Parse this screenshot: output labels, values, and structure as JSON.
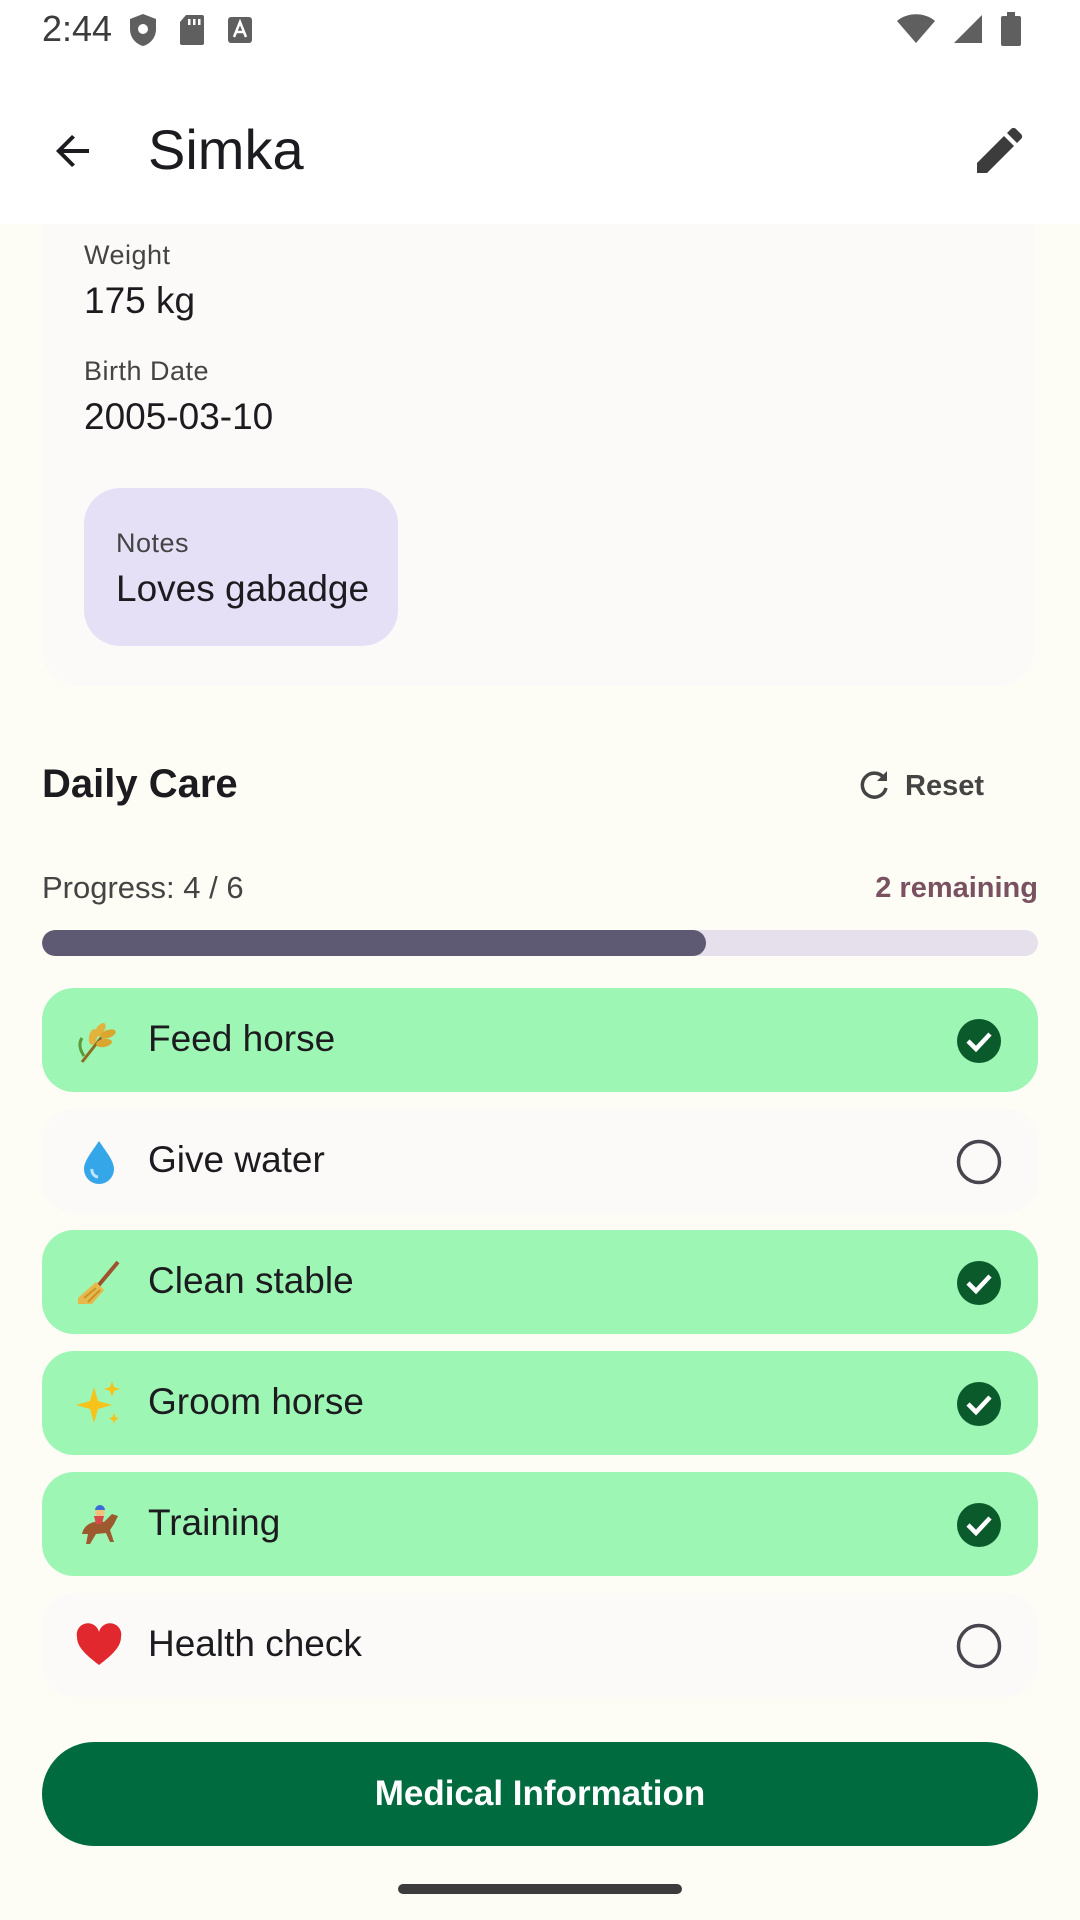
{
  "status_bar": {
    "time": "2:44"
  },
  "app_bar": {
    "title": "Simka"
  },
  "info": {
    "weight_label": "Weight",
    "weight_value": "175 kg",
    "birth_label": "Birth Date",
    "birth_value": "2005-03-10",
    "notes_label": "Notes",
    "notes_value": "Loves gabadge"
  },
  "daily_care": {
    "title": "Daily Care",
    "reset_label": "Reset",
    "progress_text": "Progress: 4 / 6",
    "remaining_text": "2 remaining",
    "progress_fraction": 0.667,
    "tasks": [
      {
        "label": "Feed horse",
        "icon": "wheat-icon",
        "done": true
      },
      {
        "label": "Give water",
        "icon": "water-drop-icon",
        "done": false
      },
      {
        "label": "Clean stable",
        "icon": "broom-icon",
        "done": true
      },
      {
        "label": "Groom horse",
        "icon": "sparkles-icon",
        "done": true
      },
      {
        "label": "Training",
        "icon": "horse-racing-icon",
        "done": true
      },
      {
        "label": "Health check",
        "icon": "heart-icon",
        "done": false
      }
    ]
  },
  "footer": {
    "medical_button_label": "Medical Information"
  },
  "colors": {
    "done_bg": "#9ef6b5",
    "check_green": "#0b5a2c",
    "primary_button": "#006b3f",
    "progress_fill": "#5e5a74",
    "notes_chip": "#e6e0f7"
  }
}
